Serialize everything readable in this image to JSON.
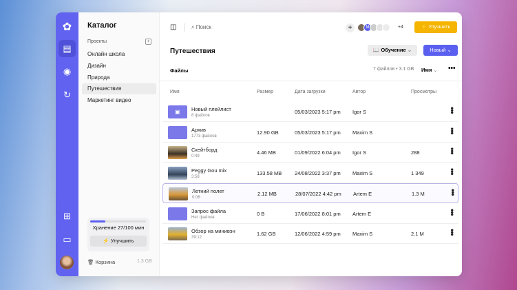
{
  "rail": {
    "icons": [
      "logo-icon",
      "folder-stack-icon",
      "broadcast-icon",
      "refresh-icon",
      "apps-icon",
      "chat-icon",
      "avatar"
    ]
  },
  "catalog": {
    "title": "Каталог",
    "projects_label": "Проекты",
    "items": [
      "Онлайн школа",
      "Дизайн",
      "Природа",
      "Путешествия",
      "Маркетинг видео"
    ],
    "selected": "Путешествия",
    "storage": {
      "label": "Хранение 27/100 мин",
      "progress": 0.27,
      "upgrade": "Улучшить"
    },
    "trash": {
      "label": "Корзина",
      "size": "1.3 GB"
    }
  },
  "topbar": {
    "search_placeholder": "Поиск",
    "extra_members": "+4",
    "upgrade": "Улучшить",
    "upgrade_color": "#f4b400"
  },
  "page": {
    "title": "Путешествия",
    "tab": "Файлы",
    "learn_button": "Обучение",
    "new_button": "Новый",
    "summary": "7 файлов • 3.1 GB",
    "sort": "Имя",
    "accent": "#5b5ff0"
  },
  "table": {
    "headers": [
      "Имя",
      "Размер",
      "Дата загрузки",
      "Автор",
      "Просмотры"
    ],
    "rows": [
      {
        "name": "Новый плейлист",
        "sub": "8 файлов",
        "size": "",
        "date": "05/03/2023 5:17 pm",
        "author": "Igor S",
        "views": "",
        "type": "playlist"
      },
      {
        "name": "Архив",
        "sub": "1773 файлов",
        "size": "12.90 GB",
        "date": "05/03/2023 5:17 pm",
        "author": "Maxim S",
        "views": "",
        "type": "folder"
      },
      {
        "name": "Скейтборд",
        "sub": "0:49",
        "size": "4.46 MB",
        "date": "01/09/2022 6:04 pm",
        "author": "Igor S",
        "views": "288",
        "type": "video"
      },
      {
        "name": "Peggy Gou mix",
        "sub": "3:58",
        "size": "133.58 MB",
        "date": "24/08/2022 3:37 pm",
        "author": "Maxim S",
        "views": "1 349",
        "type": "video"
      },
      {
        "name": "Летний полет",
        "sub": "0:06",
        "size": "2.12 MB",
        "date": "28/07/2022 4:42 pm",
        "author": "Artem E",
        "views": "1.3 M",
        "type": "video"
      },
      {
        "name": "Запрос файла",
        "sub": "Нет файлов",
        "size": "0 B",
        "date": "17/06/2022 8:01 pm",
        "author": "Artem E",
        "views": "",
        "type": "folder"
      },
      {
        "name": "Обзор на минивэн",
        "sub": "39:12",
        "size": "1.62 GB",
        "date": "12/06/2022 4:59 pm",
        "author": "Maxim S",
        "views": "2.1 M",
        "type": "video"
      }
    ]
  }
}
